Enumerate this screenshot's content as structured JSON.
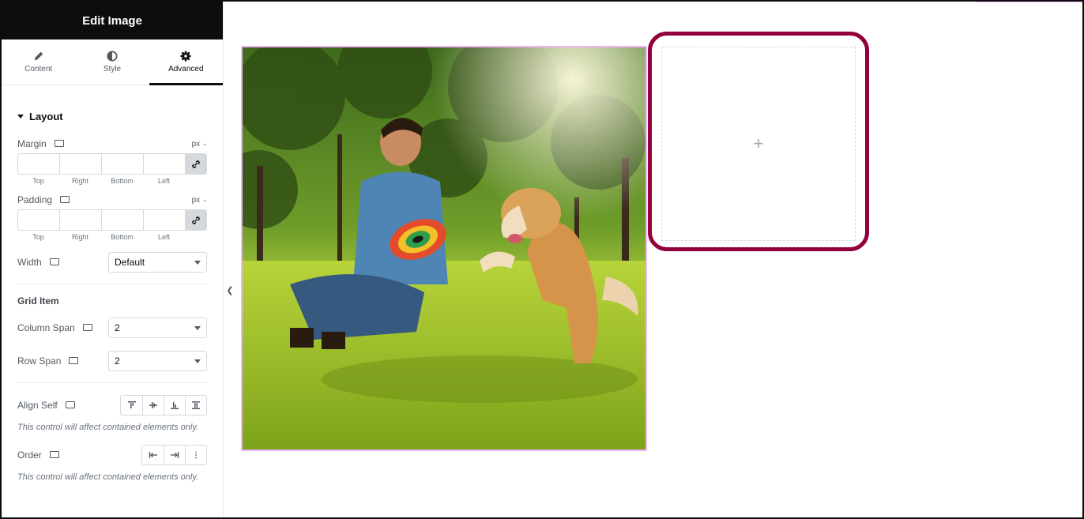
{
  "panel": {
    "title": "Edit Image",
    "tabs": [
      {
        "label": "Content",
        "icon": "pencil-icon"
      },
      {
        "label": "Style",
        "icon": "half-circle-icon"
      },
      {
        "label": "Advanced",
        "icon": "gear-icon",
        "active": true
      }
    ]
  },
  "layout": {
    "section_title": "Layout",
    "margin": {
      "label": "Margin",
      "unit": "px",
      "top": "",
      "right": "",
      "bottom": "",
      "left": "",
      "labels": [
        "Top",
        "Right",
        "Bottom",
        "Left"
      ]
    },
    "padding": {
      "label": "Padding",
      "unit": "px",
      "top": "",
      "right": "",
      "bottom": "",
      "left": "",
      "labels": [
        "Top",
        "Right",
        "Bottom",
        "Left"
      ]
    },
    "width": {
      "label": "Width",
      "value": "Default"
    }
  },
  "grid_item": {
    "title": "Grid Item",
    "column_span": {
      "label": "Column Span",
      "value": "2"
    },
    "row_span": {
      "label": "Row Span",
      "value": "2"
    }
  },
  "align_self": {
    "label": "Align Self",
    "options": [
      "align-start-icon",
      "align-center-icon",
      "align-end-icon",
      "align-stretch-icon"
    ],
    "note": "This control will affect contained elements only."
  },
  "order": {
    "label": "Order",
    "options": [
      "order-first-icon",
      "order-last-icon",
      "more-vertical-icon"
    ],
    "note": "This control will affect contained elements only."
  },
  "canvas": {
    "image_alt": "Man playing frisbee with golden retriever in park",
    "add_element_icon": "+",
    "highlight_color": "#92003b"
  }
}
